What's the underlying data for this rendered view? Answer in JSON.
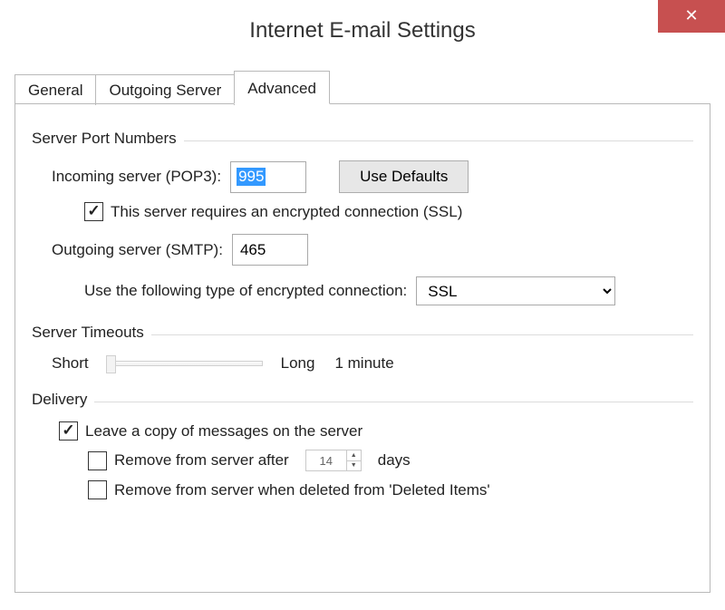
{
  "window": {
    "title": "Internet E-mail Settings",
    "close_symbol": "✕"
  },
  "tabs": {
    "general": "General",
    "outgoing": "Outgoing Server",
    "advanced": "Advanced"
  },
  "groups": {
    "server_ports": "Server Port Numbers",
    "server_timeouts": "Server Timeouts",
    "delivery": "Delivery"
  },
  "server_ports": {
    "incoming_label": "Incoming server (POP3):",
    "incoming_value": "995",
    "use_defaults": "Use Defaults",
    "ssl_required_label": "This server requires an encrypted connection (SSL)",
    "ssl_required_checked": true,
    "outgoing_label": "Outgoing server (SMTP):",
    "outgoing_value": "465",
    "enc_type_label": "Use the following type of encrypted connection:",
    "enc_type_value": "SSL"
  },
  "timeouts": {
    "short_label": "Short",
    "long_label": "Long",
    "value_label": "1 minute"
  },
  "delivery": {
    "leave_copy_label": "Leave a copy of messages on the server",
    "leave_copy_checked": true,
    "remove_after_prefix": "Remove from server after",
    "remove_after_days": "14",
    "remove_after_suffix": "days",
    "remove_after_checked": false,
    "remove_deleted_label": "Remove from server when deleted from 'Deleted Items'",
    "remove_deleted_checked": false
  }
}
